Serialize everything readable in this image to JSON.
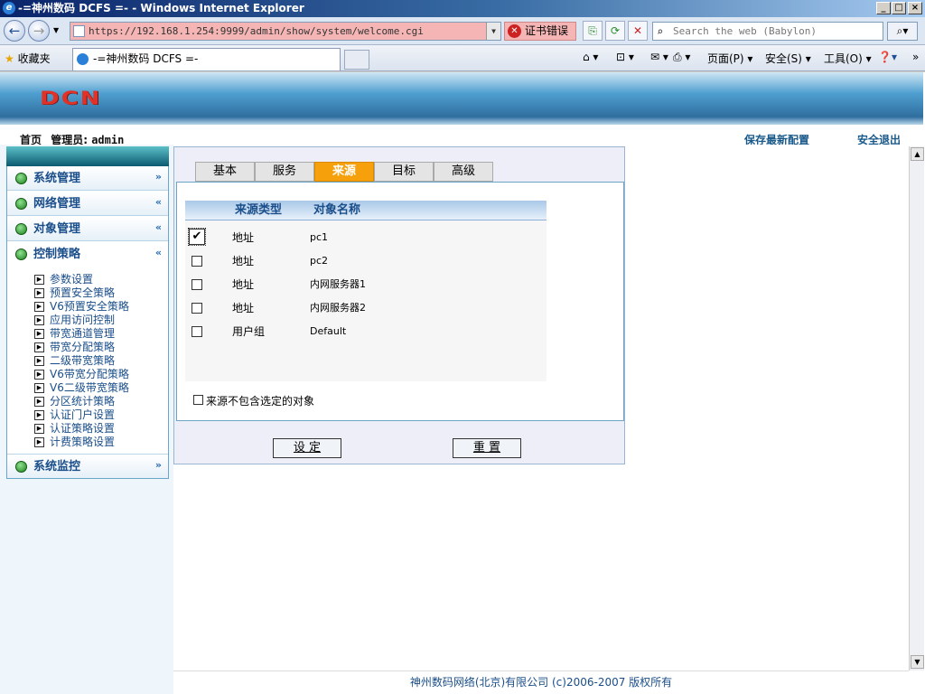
{
  "window": {
    "title": "-=神州数码 DCFS =- - Windows Internet Explorer"
  },
  "address_bar": {
    "url": "https://192.168.1.254:9999/admin/show/system/welcome.cgi",
    "cert_error": "证书错误",
    "search_placeholder": "Search the web (Babylon)"
  },
  "fav_bar": {
    "favorites_label": "收藏夹",
    "tab_title": "-=神州数码 DCFS =-",
    "page_menu": "页面(P)",
    "safety_menu": "安全(S)",
    "tools_menu": "工具(O)"
  },
  "header": {
    "logo_text": "DCN",
    "home": "首页",
    "admin_label": "管理员:",
    "admin_user": "admin",
    "save_config": "保存最新配置",
    "logout": "安全退出"
  },
  "sidebar": {
    "groups": [
      {
        "label": "系统管理",
        "chevron": "»"
      },
      {
        "label": "网络管理",
        "chevron": "«"
      },
      {
        "label": "对象管理",
        "chevron": "«"
      },
      {
        "label": "控制策略",
        "chevron": "«"
      }
    ],
    "items": [
      "参数设置",
      "预置安全策略",
      "V6预置安全策略",
      "应用访问控制",
      "带宽通道管理",
      "带宽分配策略",
      "二级带宽策略",
      "V6带宽分配策略",
      "V6二级带宽策略",
      "分区统计策略",
      "认证门户设置",
      "认证策略设置",
      "计费策略设置"
    ],
    "monitor": {
      "label": "系统监控",
      "chevron": "»"
    }
  },
  "tabs": [
    "基本",
    "服务",
    "来源",
    "目标",
    "高级"
  ],
  "active_tab": "来源",
  "table": {
    "headers": [
      "来源类型",
      "对象名称"
    ],
    "rows": [
      {
        "type": "地址",
        "name": "pc1",
        "checked": true
      },
      {
        "type": "地址",
        "name": "pc2",
        "checked": false
      },
      {
        "type": "地址",
        "name": "内网服务器1",
        "checked": false
      },
      {
        "type": "地址",
        "name": "内网服务器2",
        "checked": false
      },
      {
        "type": "用户组",
        "name": "Default",
        "checked": false
      }
    ]
  },
  "exclude_label": "来源不包含选定的对象",
  "buttons": {
    "set": "设 定",
    "reset": "重 置"
  },
  "footer": "神州数码网络(北京)有限公司 (c)2006-2007 版权所有"
}
